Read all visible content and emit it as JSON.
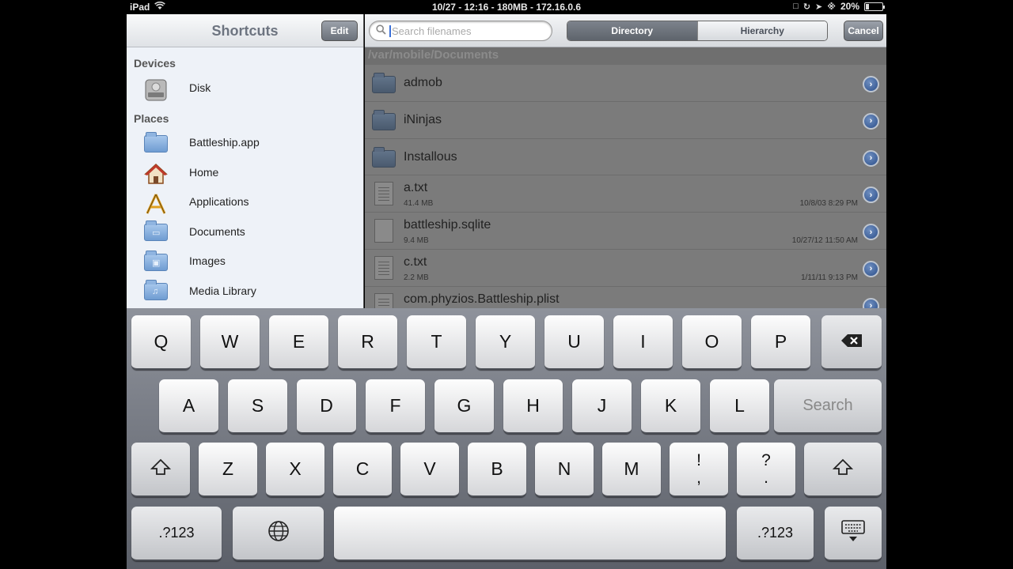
{
  "status_bar": {
    "device": "iPad",
    "center": "10/27 - 12:16 - 180MB - 172.16.0.6",
    "battery": "20%",
    "battery_fraction": 0.2
  },
  "shortcuts": {
    "title": "Shortcuts",
    "edit_label": "Edit",
    "sections": [
      {
        "header": "Devices",
        "items": [
          {
            "label": "Disk",
            "icon": "disk-icon"
          }
        ]
      },
      {
        "header": "Places",
        "items": [
          {
            "label": "Battleship.app",
            "icon": "folder-icon"
          },
          {
            "label": "Home",
            "icon": "home-icon"
          },
          {
            "label": "Applications",
            "icon": "applications-icon"
          },
          {
            "label": "Documents",
            "icon": "documents-folder-icon"
          },
          {
            "label": "Images",
            "icon": "images-folder-icon"
          },
          {
            "label": "Media Library",
            "icon": "music-folder-icon"
          }
        ]
      }
    ]
  },
  "browser": {
    "search_placeholder": "Search filenames",
    "segments": [
      "Directory",
      "Hierarchy"
    ],
    "active_segment": "Directory",
    "cancel_label": "Cancel",
    "path": "/var/mobile/Documents",
    "files": [
      {
        "name": "admob",
        "type": "folder"
      },
      {
        "name": "iNinjas",
        "type": "folder"
      },
      {
        "name": "Installous",
        "type": "folder"
      },
      {
        "name": "a.txt",
        "type": "text",
        "size": "41.4 MB",
        "date": "10/8/03 8:29 PM"
      },
      {
        "name": "battleship.sqlite",
        "type": "file",
        "size": "9.4 MB",
        "date": "10/27/12 11:50 AM"
      },
      {
        "name": "c.txt",
        "type": "text",
        "size": "2.2 MB",
        "date": "1/11/11 9:13 PM"
      },
      {
        "name": "com.phyzios.Battleship.plist",
        "type": "text",
        "size": "",
        "date": ""
      }
    ]
  },
  "keyboard": {
    "row1": [
      "Q",
      "W",
      "E",
      "R",
      "T",
      "Y",
      "U",
      "I",
      "O",
      "P"
    ],
    "row2": [
      "A",
      "S",
      "D",
      "F",
      "G",
      "H",
      "J",
      "K",
      "L"
    ],
    "search_label": "Search",
    "row3": [
      "Z",
      "X",
      "C",
      "V",
      "B",
      "N",
      "M"
    ],
    "punct1": [
      "!",
      ","
    ],
    "punct2": [
      "?",
      "."
    ],
    "numbers_label": ".?123"
  }
}
